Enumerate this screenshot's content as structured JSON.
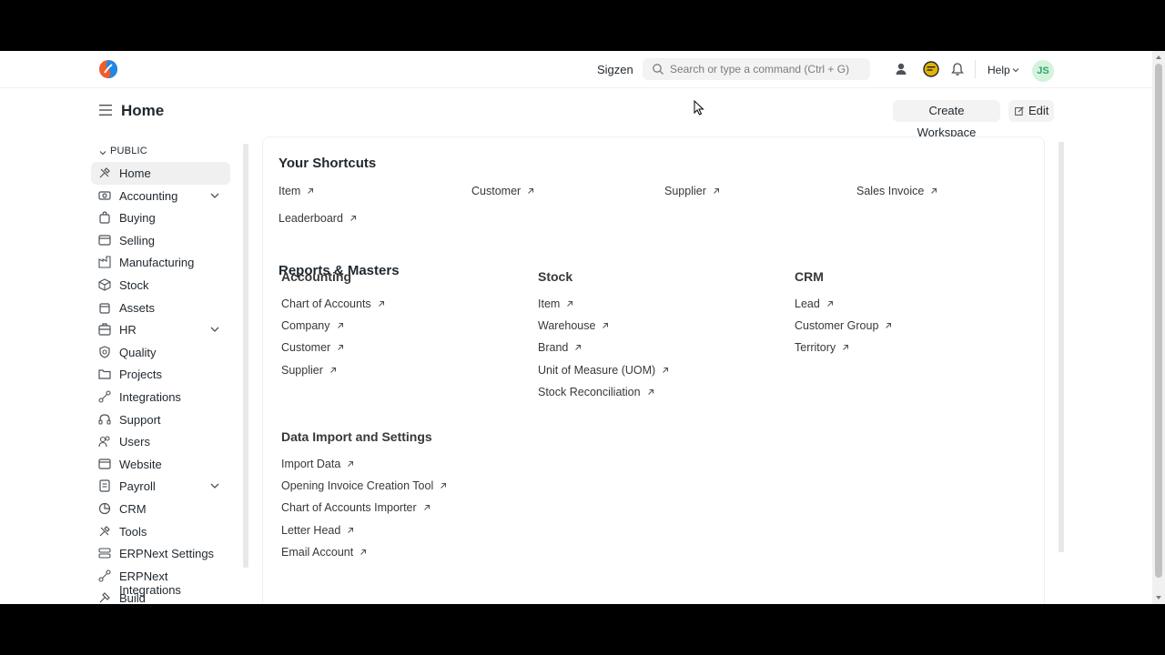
{
  "navbar": {
    "company": "Sigzen",
    "search_placeholder": "Search or type a command (Ctrl + G)",
    "help_label": "Help",
    "avatar_initials": "JS"
  },
  "page": {
    "title": "Home",
    "create_workspace_label": "Create Workspace",
    "edit_label": "Edit"
  },
  "sidebar": {
    "section_label": "PUBLIC",
    "items": [
      {
        "label": "Home",
        "icon": "tools-icon",
        "active": true
      },
      {
        "label": "Accounting",
        "icon": "accounting-icon",
        "expandable": true
      },
      {
        "label": "Buying",
        "icon": "buying-icon"
      },
      {
        "label": "Selling",
        "icon": "selling-icon"
      },
      {
        "label": "Manufacturing",
        "icon": "factory-icon"
      },
      {
        "label": "Stock",
        "icon": "box-icon"
      },
      {
        "label": "Assets",
        "icon": "assets-icon"
      },
      {
        "label": "HR",
        "icon": "hr-icon",
        "expandable": true
      },
      {
        "label": "Quality",
        "icon": "quality-icon"
      },
      {
        "label": "Projects",
        "icon": "folder-icon"
      },
      {
        "label": "Integrations",
        "icon": "integration-icon"
      },
      {
        "label": "Support",
        "icon": "headset-icon"
      },
      {
        "label": "Users",
        "icon": "users-icon"
      },
      {
        "label": "Website",
        "icon": "website-icon"
      },
      {
        "label": "Payroll",
        "icon": "payroll-icon",
        "expandable": true
      },
      {
        "label": "CRM",
        "icon": "crm-icon"
      },
      {
        "label": "Tools",
        "icon": "tools-icon"
      },
      {
        "label": "ERPNext Settings",
        "icon": "settings-icon"
      },
      {
        "label": "ERPNext Integrations",
        "icon": "integration-icon"
      },
      {
        "label": "Build",
        "icon": "build-icon"
      }
    ]
  },
  "shortcuts": {
    "title": "Your Shortcuts",
    "items": [
      "Item",
      "Customer",
      "Supplier",
      "Sales Invoice",
      "Leaderboard"
    ]
  },
  "reports": {
    "title": "Reports & Masters",
    "cards": [
      {
        "title": "Accounting",
        "links": [
          "Chart of Accounts",
          "Company",
          "Customer",
          "Supplier"
        ]
      },
      {
        "title": "Stock",
        "links": [
          "Item",
          "Warehouse",
          "Brand",
          "Unit of Measure (UOM)",
          "Stock Reconciliation"
        ]
      },
      {
        "title": "CRM",
        "links": [
          "Lead",
          "Customer Group",
          "Territory"
        ]
      },
      {
        "title": "Data Import and Settings",
        "links": [
          "Import Data",
          "Opening Invoice Creation Tool",
          "Chart of Accounts Importer",
          "Letter Head",
          "Email Account"
        ]
      }
    ]
  },
  "colors": {
    "text": "#1f272e",
    "avatar_bg": "#d5f2dc",
    "avatar_fg": "#30a66d",
    "logo_orange": "#f15a29",
    "logo_blue": "#1e88e5"
  }
}
